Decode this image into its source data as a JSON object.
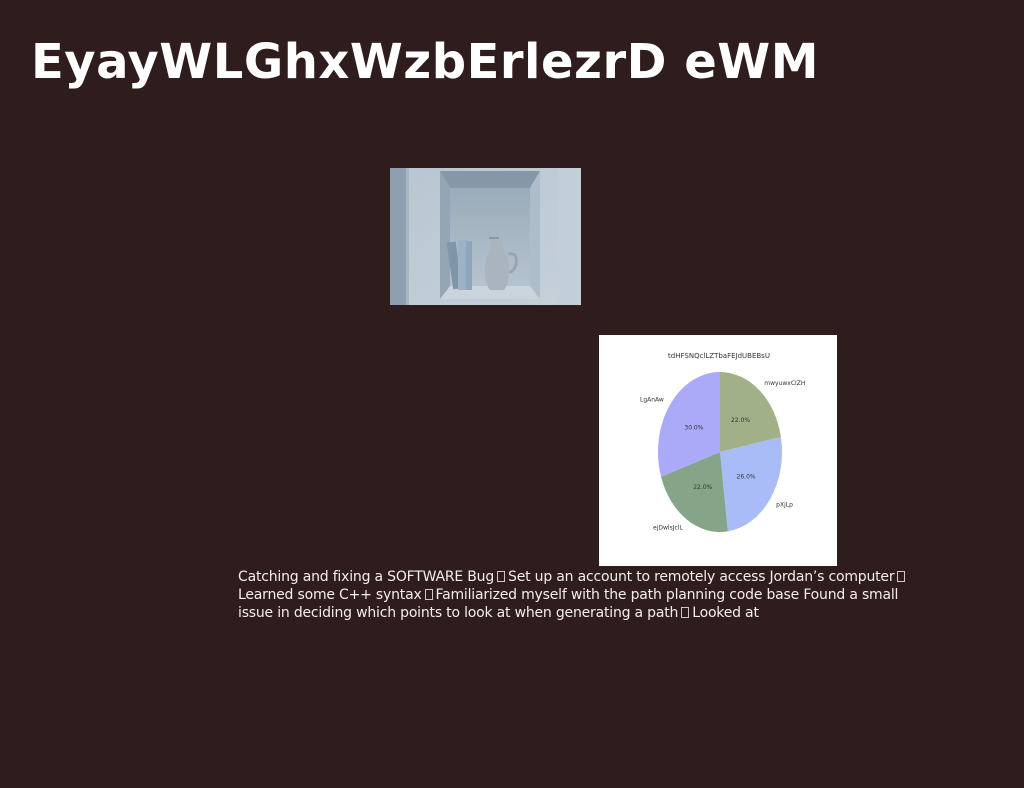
{
  "slide": {
    "title": "EyayWLGhxWzbErlezrD eWM",
    "body_segments": [
      "Catching and fixing a SOFTWARE Bug",
      "Set up an account to remotely access Jordan’s computer",
      "Learned some C++ syntax",
      "Familiarized myself with the path planning code base Found a small issue in deciding which points to look at when generating a path",
      "Looked at"
    ]
  },
  "colors": {
    "background": "#2f1d1d",
    "title": "#ffffff",
    "body_text": "#f2eeee"
  },
  "photo": {
    "subject": "wall niche with books and vase"
  },
  "chart_data": {
    "type": "pie",
    "title": "tdHFSNQclLZTbaFEJdUBEBsU",
    "categories": [
      "mwyuwxCIZH",
      "pXjLp",
      "ejDwlsJclL",
      "LgAnAw"
    ],
    "values": [
      22.0,
      26.0,
      22.0,
      30.0
    ],
    "value_labels": [
      "22.0%",
      "26.0%",
      "22.0%",
      "30.0%"
    ],
    "colors": [
      "#a2b087",
      "#aabcf8",
      "#86a487",
      "#abaaf8"
    ],
    "start_angle": 90,
    "direction": "clockwise",
    "legend": "none"
  }
}
